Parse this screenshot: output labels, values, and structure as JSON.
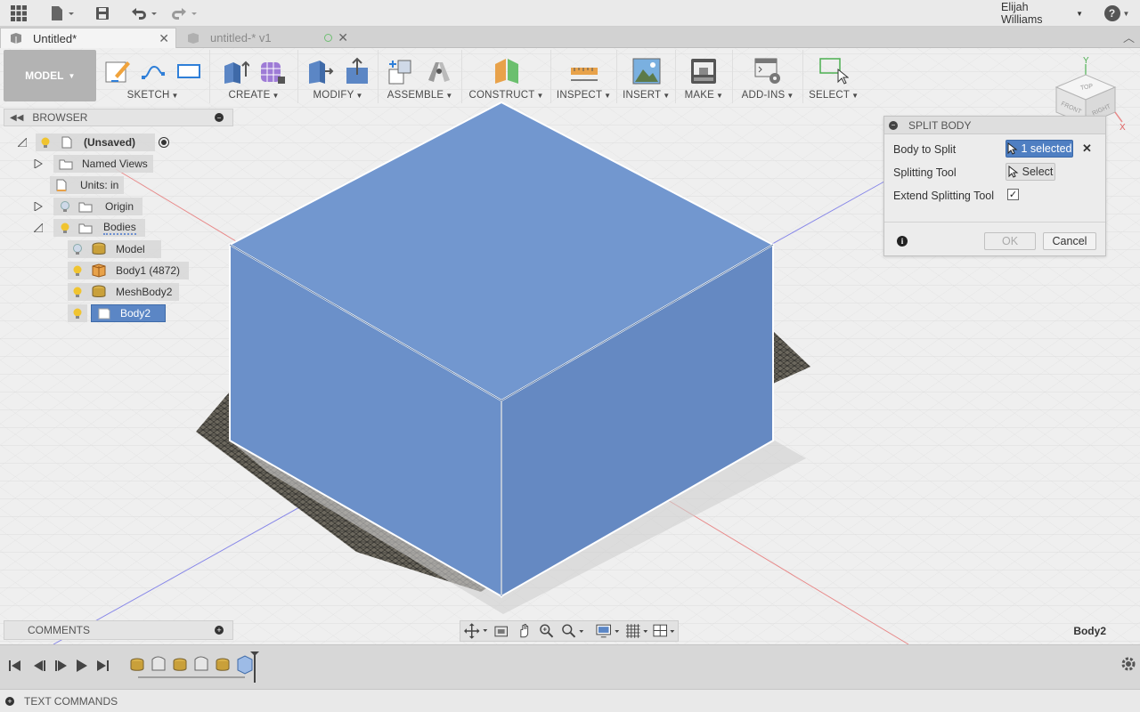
{
  "topbar": {
    "user_name": "Elijah Williams",
    "help_symbol": "?"
  },
  "tabs": [
    {
      "label": "Untitled*"
    },
    {
      "label": "untitled-* v1"
    }
  ],
  "toolbar": {
    "mode_label": "MODEL",
    "groups": [
      "SKETCH",
      "CREATE",
      "MODIFY",
      "ASSEMBLE",
      "CONSTRUCT",
      "INSPECT",
      "INSERT",
      "MAKE",
      "ADD-INS",
      "SELECT"
    ]
  },
  "browser": {
    "title": "BROWSER",
    "root": "(Unsaved)",
    "named_views": "Named Views",
    "units": "Units: in",
    "origin": "Origin",
    "bodies": "Bodies",
    "items": [
      "Model",
      "Body1 (4872)",
      "MeshBody2",
      "Body2"
    ]
  },
  "comments": {
    "title": "COMMENTS"
  },
  "dialog": {
    "title": "SPLIT BODY",
    "body_to_split_label": "Body to Split",
    "body_to_split_value": "1 selected",
    "splitting_tool_label": "Splitting Tool",
    "splitting_tool_value": "Select",
    "extend_label": "Extend Splitting Tool",
    "extend_checked": true,
    "ok_label": "OK",
    "cancel_label": "Cancel"
  },
  "status": {
    "selection": "Body2"
  },
  "viewcube": {
    "top": "TOP",
    "front": "FRONT",
    "right": "RIGHT",
    "axis_x": "X",
    "axis_y": "Y"
  },
  "text_commands": {
    "label": "TEXT COMMANDS"
  },
  "colors": {
    "body": "#6f93cc",
    "selected": "#5b86c5",
    "mesh": "#4a4842"
  },
  "icons": [
    "apps-grid-icon",
    "file-icon",
    "save-icon",
    "undo-icon",
    "redo-icon",
    "help-icon",
    "sketch-icon",
    "line-icon",
    "rectangle-icon",
    "extrude-icon",
    "form-icon",
    "push-pull-icon",
    "press-pull-icon",
    "new-component-icon",
    "joint-icon",
    "plane-icon",
    "measure-icon",
    "insert-image-icon",
    "3d-print-icon",
    "scripts-icon",
    "select-icon"
  ]
}
